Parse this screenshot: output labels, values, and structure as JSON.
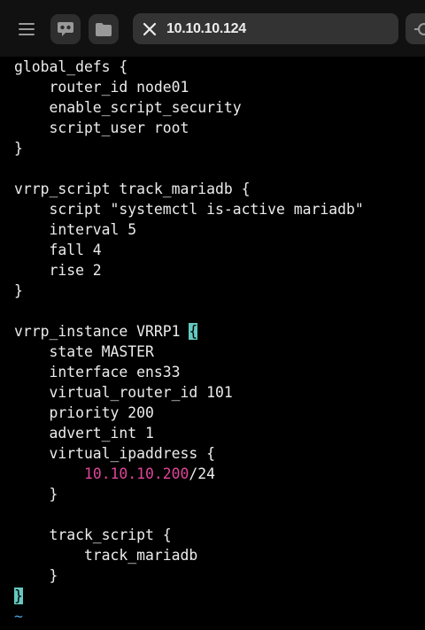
{
  "toolbar": {
    "menu_icon": "menu-icon",
    "chat_icon": "chat-bubble-icon",
    "folder_icon": "folder-icon",
    "address": "10.10.10.124",
    "close_icon": "close-icon",
    "side_icon": "network-icon"
  },
  "editor": {
    "lines": [
      "global_defs {",
      "    router_id node01",
      "    enable_script_security",
      "    script_user root",
      "}",
      "",
      "vrrp_script track_mariadb {",
      "    script \"systemctl is-active mariadb\"",
      "    interval 5",
      "    fall 4",
      "    rise 2",
      "}",
      "",
      "vrrp_instance VRRP1 ",
      "    state MASTER",
      "    interface ens33",
      "    virtual_router_id 101",
      "    priority 200",
      "    advert_int 1",
      "    virtual_ipaddress {",
      "        ",
      "    }",
      "",
      "    track_script {",
      "        track_mariadb",
      "    }",
      ""
    ],
    "open_bracket": "{",
    "ip_indent": "        ",
    "ip_address": "10.10.10.200",
    "ip_suffix": "/24",
    "closing_bracket": "}",
    "tilde": "~"
  },
  "colors": {
    "background": "#000000",
    "text": "#ececec",
    "ip_highlight": "#e0449a",
    "cursor": "#64c9c0",
    "tilde": "#4aa3d9"
  }
}
